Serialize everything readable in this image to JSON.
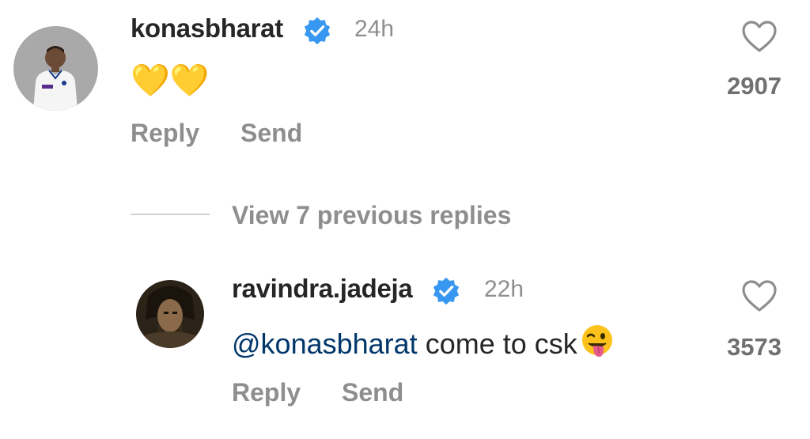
{
  "comments": [
    {
      "username": "konasbharat",
      "time": "24h",
      "text_emoji": "💛💛",
      "likes": "2907",
      "reply_label": "Reply",
      "send_label": "Send"
    },
    {
      "username": "ravindra.jadeja",
      "time": "22h",
      "mention": "@konasbharat",
      "text": " come to csk",
      "likes": "3573",
      "reply_label": "Reply",
      "send_label": "Send"
    }
  ],
  "thread": {
    "view_replies_label": "View 7 previous replies"
  },
  "icons": {
    "verified": "verified-badge-icon",
    "like": "heart-outline-icon"
  },
  "colors": {
    "verified_blue": "#3897f0",
    "mention": "#00376b",
    "heart_emoji": "#ffcc00"
  }
}
